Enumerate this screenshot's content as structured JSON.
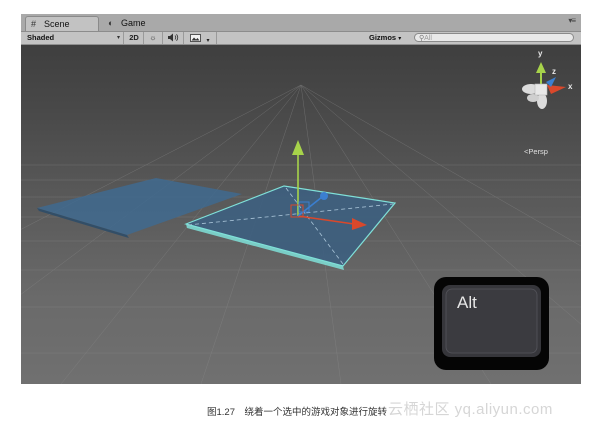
{
  "tabs": {
    "scene": {
      "label": "Scene",
      "icon": "scene-grid-icon"
    },
    "game": {
      "label": "Game",
      "icon": "game-pacman-icon"
    },
    "window_menu_icon": "tab-menu-icon"
  },
  "toolbar": {
    "shading_mode": "Shaded",
    "mode_2d_label": "2D",
    "lighting_icon": "sun-icon",
    "audio_icon": "speaker-icon",
    "effects_icon": "image-effects-icon",
    "gizmos_label": "Gizmos",
    "search_placeholder": "All"
  },
  "viewport": {
    "camera_label": "Persp",
    "axis_labels": {
      "x": "x",
      "y": "y",
      "z": "z"
    },
    "key_overlay_label": "Alt",
    "colors": {
      "x_axis": "#d9482b",
      "y_axis": "#a7d34a",
      "z_axis": "#3b7fd0",
      "selection_outline": "#7fe0d8",
      "plane": "#3f6a8f"
    }
  },
  "caption": "图1.27　绕着一个选中的游戏对象进行旋转",
  "watermark": "云栖社区 yq.aliyun.com"
}
